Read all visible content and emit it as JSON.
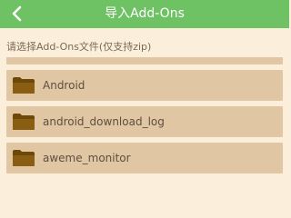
{
  "header": {
    "title": "导入Add-Ons",
    "background_color": "#6ec264"
  },
  "hint": "请选择Add-Ons文件(仅支持zip)",
  "files": [
    {
      "name": "",
      "icon": "folder-icon"
    },
    {
      "name": "Android",
      "icon": "folder-icon"
    },
    {
      "name": "android_download_log",
      "icon": "folder-icon"
    },
    {
      "name": "aweme_monitor",
      "icon": "folder-icon"
    }
  ],
  "colors": {
    "page_background": "#fbeedb",
    "row_background": "#e0c6a3",
    "folder": "#7c5310"
  }
}
